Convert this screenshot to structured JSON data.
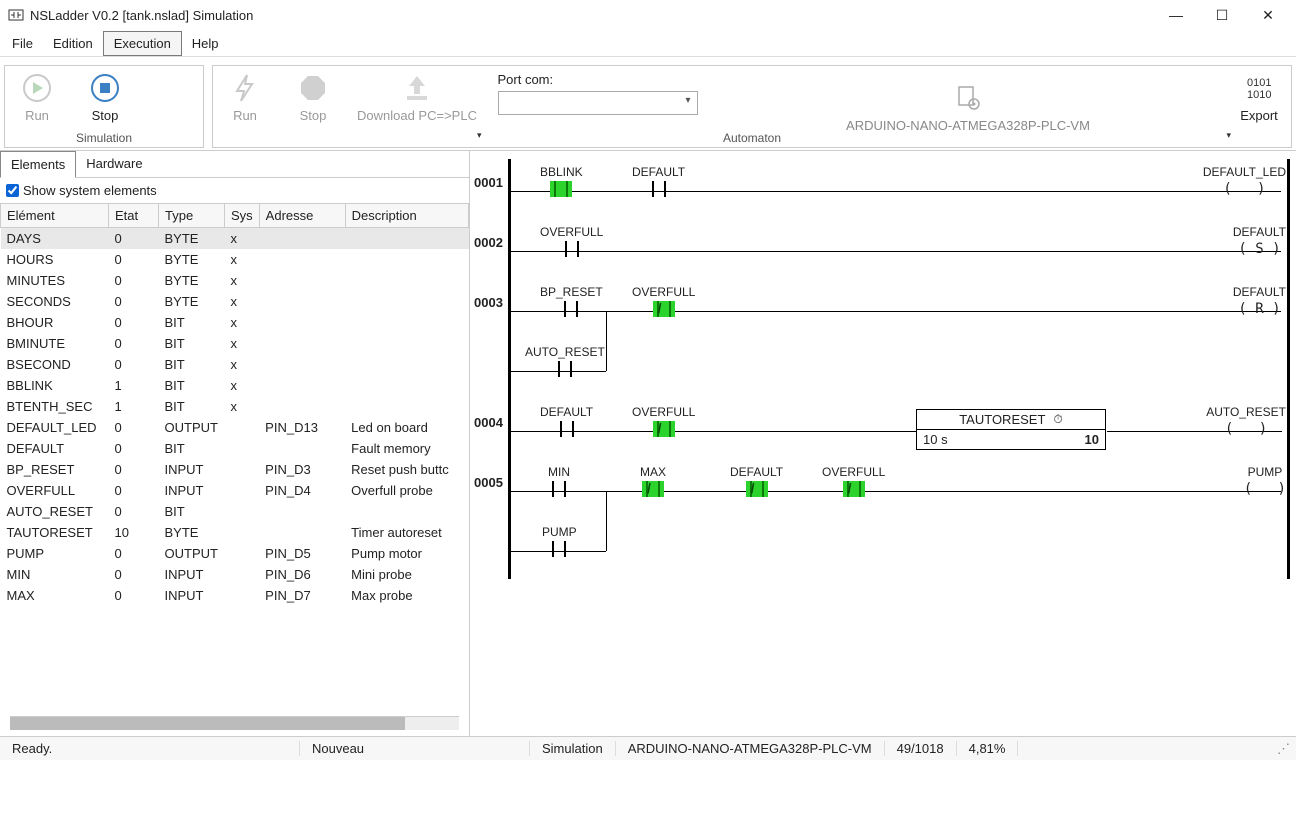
{
  "window": {
    "title": "NSLadder V0.2  [tank.nslad] Simulation"
  },
  "menu": {
    "file": "File",
    "edition": "Edition",
    "execution": "Execution",
    "help": "Help"
  },
  "ribbon": {
    "sim": {
      "run": "Run",
      "stop": "Stop",
      "group": "Simulation"
    },
    "auto": {
      "run": "Run",
      "stop": "Stop",
      "download": "Download PC=>PLC",
      "port_label": "Port com:",
      "plc_name": "ARDUINO-NANO-ATMEGA328P-PLC-VM",
      "export": "Export",
      "group": "Automaton"
    }
  },
  "tabs": {
    "elements": "Elements",
    "hardware": "Hardware"
  },
  "show_system": "Show system elements",
  "table": {
    "headers": {
      "element": "Elément",
      "etat": "Etat",
      "type": "Type",
      "sys": "Sys",
      "adresse": "Adresse",
      "description": "Description"
    },
    "rows": [
      {
        "el": "DAYS",
        "etat": "0",
        "type": "BYTE",
        "sys": "x",
        "addr": "",
        "desc": ""
      },
      {
        "el": "HOURS",
        "etat": "0",
        "type": "BYTE",
        "sys": "x",
        "addr": "",
        "desc": ""
      },
      {
        "el": "MINUTES",
        "etat": "0",
        "type": "BYTE",
        "sys": "x",
        "addr": "",
        "desc": ""
      },
      {
        "el": "SECONDS",
        "etat": "0",
        "type": "BYTE",
        "sys": "x",
        "addr": "",
        "desc": ""
      },
      {
        "el": "BHOUR",
        "etat": "0",
        "type": "BIT",
        "sys": "x",
        "addr": "",
        "desc": ""
      },
      {
        "el": "BMINUTE",
        "etat": "0",
        "type": "BIT",
        "sys": "x",
        "addr": "",
        "desc": ""
      },
      {
        "el": "BSECOND",
        "etat": "0",
        "type": "BIT",
        "sys": "x",
        "addr": "",
        "desc": ""
      },
      {
        "el": "BBLINK",
        "etat": "1",
        "type": "BIT",
        "sys": "x",
        "addr": "",
        "desc": ""
      },
      {
        "el": "BTENTH_SEC",
        "etat": "1",
        "type": "BIT",
        "sys": "x",
        "addr": "",
        "desc": ""
      },
      {
        "el": "DEFAULT_LED",
        "etat": "0",
        "type": "OUTPUT",
        "sys": "",
        "addr": "PIN_D13",
        "desc": "Led on board"
      },
      {
        "el": "DEFAULT",
        "etat": "0",
        "type": "BIT",
        "sys": "",
        "addr": "",
        "desc": "Fault memory"
      },
      {
        "el": "BP_RESET",
        "etat": "0",
        "type": "INPUT",
        "sys": "",
        "addr": "PIN_D3",
        "desc": "Reset push buttc"
      },
      {
        "el": "OVERFULL",
        "etat": "0",
        "type": "INPUT",
        "sys": "",
        "addr": "PIN_D4",
        "desc": "Overfull probe"
      },
      {
        "el": "AUTO_RESET",
        "etat": "0",
        "type": "BIT",
        "sys": "",
        "addr": "",
        "desc": ""
      },
      {
        "el": "TAUTORESET",
        "etat": "10",
        "type": "BYTE",
        "sys": "",
        "addr": "",
        "desc": "Timer autoreset"
      },
      {
        "el": "PUMP",
        "etat": "0",
        "type": "OUTPUT",
        "sys": "",
        "addr": "PIN_D5",
        "desc": "Pump motor"
      },
      {
        "el": "MIN",
        "etat": "0",
        "type": "INPUT",
        "sys": "",
        "addr": "PIN_D6",
        "desc": "Mini probe"
      },
      {
        "el": "MAX",
        "etat": "0",
        "type": "INPUT",
        "sys": "",
        "addr": "PIN_D7",
        "desc": "Max probe"
      }
    ]
  },
  "ladder": {
    "rungs": [
      "0001",
      "0002",
      "0003",
      "0004",
      "0005"
    ],
    "r1": {
      "bblink": "BBLINK",
      "default": "DEFAULT",
      "out": "DEFAULT_LED"
    },
    "r2": {
      "overfull": "OVERFULL",
      "out": "DEFAULT",
      "coil": "( S )"
    },
    "r3": {
      "bp_reset": "BP_RESET",
      "overfull": "OVERFULL",
      "auto_reset": "AUTO_RESET",
      "out": "DEFAULT",
      "coil": "( R )"
    },
    "r4": {
      "default": "DEFAULT",
      "overfull": "OVERFULL",
      "timer_name": "TAUTORESET",
      "timer_left": "10 s",
      "timer_right": "10",
      "out": "AUTO_RESET"
    },
    "r5": {
      "min": "MIN",
      "max": "MAX",
      "default": "DEFAULT",
      "overfull": "OVERFULL",
      "pump": "PUMP",
      "out": "PUMP"
    }
  },
  "status": {
    "ready": "Ready.",
    "nouveau": "Nouveau",
    "mode": "Simulation",
    "plc": "ARDUINO-NANO-ATMEGA328P-PLC-VM",
    "mem": "49/1018",
    "pct": "4,81%"
  }
}
